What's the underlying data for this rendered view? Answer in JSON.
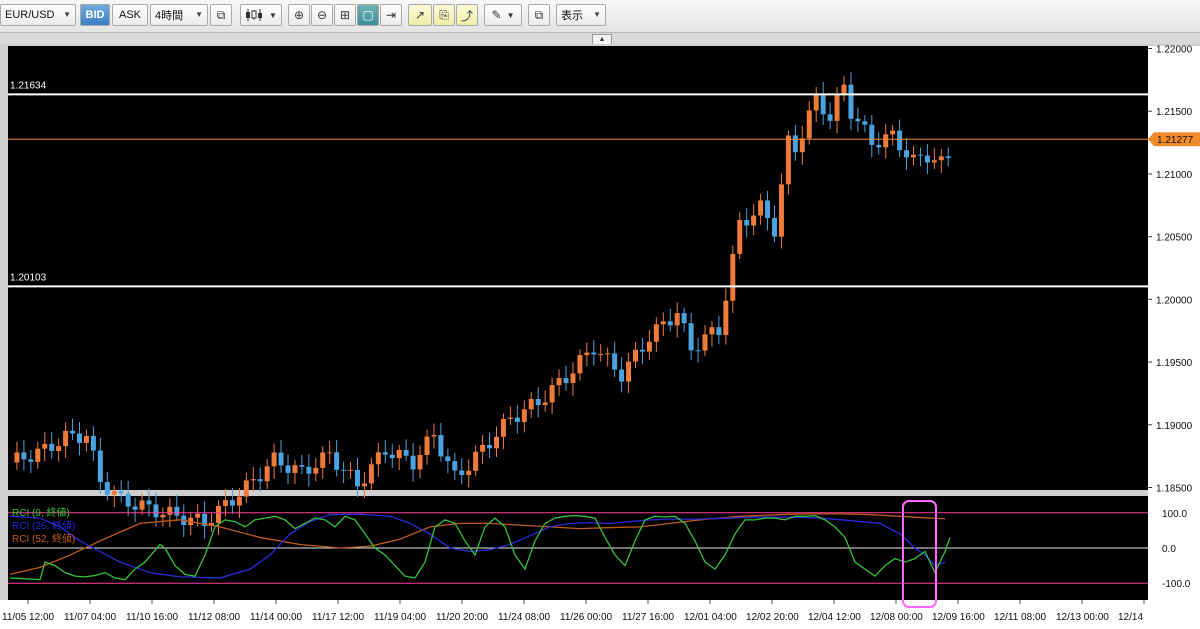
{
  "toolbar": {
    "symbol": "EUR/USD",
    "bid_label": "BID",
    "ask_label": "ASK",
    "timeframe": "4時間",
    "display_label": "表示"
  },
  "chart_data": {
    "type": "candlestick",
    "symbol": "EUR/USD",
    "timeframe": "4h",
    "price_axis": {
      "ylim": [
        1.1848,
        1.2202
      ],
      "ticks": [
        1.22,
        1.215,
        1.21,
        1.205,
        1.2,
        1.195,
        1.19,
        1.185
      ]
    },
    "x_labels": [
      "11/05 12:00",
      "11/07 04:00",
      "11/10 16:00",
      "11/12 08:00",
      "11/14 00:00",
      "11/17 12:00",
      "11/19 04:00",
      "11/20 20:00",
      "11/24 08:00",
      "11/26 00:00",
      "11/27 16:00",
      "12/01 04:00",
      "12/02 20:00",
      "12/04 12:00",
      "12/08 00:00",
      "12/09 16:00",
      "12/11 08:00",
      "12/13 00:00",
      "12/14"
    ],
    "horizontal_lines": [
      {
        "label": "1.21634",
        "value": 1.21634,
        "color": "#ffffff"
      },
      {
        "label": "1.20103",
        "value": 1.20103,
        "color": "#ffffff"
      },
      {
        "label": "1.21277",
        "value": 1.21277,
        "color": "#f08a2c",
        "current_price": true
      }
    ],
    "bull_color": "#ef7b3a",
    "bear_color": "#4aa3df",
    "close_path": [
      [
        0,
        1.187
      ],
      [
        5,
        1.188
      ],
      [
        8,
        1.189
      ],
      [
        11,
        1.1892
      ],
      [
        13,
        1.1855
      ],
      [
        16,
        1.184
      ],
      [
        22,
        1.183
      ],
      [
        28,
        1.1822
      ],
      [
        34,
        1.185
      ],
      [
        38,
        1.1872
      ],
      [
        42,
        1.1862
      ],
      [
        46,
        1.1876
      ],
      [
        50,
        1.1852
      ],
      [
        54,
        1.188
      ],
      [
        58,
        1.187
      ],
      [
        61,
        1.1892
      ],
      [
        64,
        1.1858
      ],
      [
        66,
        1.1868
      ],
      [
        72,
        1.1905
      ],
      [
        76,
        1.1918
      ],
      [
        80,
        1.1938
      ],
      [
        84,
        1.1962
      ],
      [
        88,
        1.194
      ],
      [
        92,
        1.197
      ],
      [
        96,
        1.199
      ],
      [
        98,
        1.196
      ],
      [
        100,
        1.197
      ],
      [
        102,
        1.1975
      ],
      [
        105,
        1.206
      ],
      [
        108,
        1.2073
      ],
      [
        110,
        1.2056
      ],
      [
        112,
        1.2125
      ],
      [
        113,
        1.212
      ],
      [
        116,
        1.216
      ],
      [
        118,
        1.2145
      ],
      [
        120,
        1.217
      ],
      [
        121,
        1.215
      ],
      [
        124,
        1.2125
      ],
      [
        127,
        1.213
      ],
      [
        130,
        1.211
      ],
      [
        132,
        1.2115
      ],
      [
        134,
        1.2108
      ],
      [
        137,
        1.2125
      ]
    ],
    "candles_start_x": 10,
    "candle_spacing": 6.95,
    "rci_panel": {
      "title": "RCI",
      "ylim": [
        -100,
        100
      ],
      "ticks": [
        100.0,
        0.0,
        -100.0
      ],
      "reference_lines": [
        80,
        0,
        -80
      ],
      "series": [
        {
          "name": "RCI (9, 終値)",
          "color": "#35c23a",
          "values": [
            [
              10,
              -85
            ],
            [
              40,
              -90
            ],
            [
              45,
              -40
            ],
            [
              55,
              -50
            ],
            [
              65,
              -70
            ],
            [
              75,
              -80
            ],
            [
              85,
              -82
            ],
            [
              95,
              -78
            ],
            [
              105,
              -70
            ],
            [
              115,
              -85
            ],
            [
              125,
              -90
            ],
            [
              135,
              -60
            ],
            [
              145,
              -40
            ],
            [
              160,
              10
            ],
            [
              165,
              0
            ],
            [
              175,
              -50
            ],
            [
              185,
              -75
            ],
            [
              195,
              -80
            ],
            [
              205,
              -20
            ],
            [
              215,
              60
            ],
            [
              225,
              80
            ],
            [
              235,
              75
            ],
            [
              245,
              60
            ],
            [
              255,
              80
            ],
            [
              265,
              85
            ],
            [
              275,
              90
            ],
            [
              285,
              80
            ],
            [
              295,
              55
            ],
            [
              305,
              70
            ],
            [
              315,
              85
            ],
            [
              325,
              80
            ],
            [
              335,
              60
            ],
            [
              345,
              90
            ],
            [
              355,
              80
            ],
            [
              365,
              40
            ],
            [
              375,
              0
            ],
            [
              385,
              -20
            ],
            [
              395,
              -50
            ],
            [
              405,
              -80
            ],
            [
              415,
              -85
            ],
            [
              425,
              -40
            ],
            [
              435,
              60
            ],
            [
              445,
              80
            ],
            [
              455,
              70
            ],
            [
              465,
              20
            ],
            [
              475,
              -20
            ],
            [
              485,
              60
            ],
            [
              495,
              85
            ],
            [
              505,
              60
            ],
            [
              515,
              -20
            ],
            [
              525,
              -60
            ],
            [
              535,
              20
            ],
            [
              545,
              70
            ],
            [
              555,
              85
            ],
            [
              565,
              90
            ],
            [
              575,
              92
            ],
            [
              585,
              90
            ],
            [
              595,
              85
            ],
            [
              605,
              30
            ],
            [
              615,
              -20
            ],
            [
              625,
              -50
            ],
            [
              635,
              20
            ],
            [
              645,
              80
            ],
            [
              655,
              90
            ],
            [
              665,
              88
            ],
            [
              675,
              90
            ],
            [
              685,
              70
            ],
            [
              695,
              20
            ],
            [
              705,
              -40
            ],
            [
              715,
              -60
            ],
            [
              725,
              -20
            ],
            [
              735,
              40
            ],
            [
              745,
              80
            ],
            [
              755,
              80
            ],
            [
              765,
              85
            ],
            [
              775,
              85
            ],
            [
              785,
              80
            ],
            [
              795,
              90
            ],
            [
              805,
              90
            ],
            [
              815,
              92
            ],
            [
              825,
              80
            ],
            [
              835,
              60
            ],
            [
              845,
              30
            ],
            [
              855,
              -40
            ],
            [
              865,
              -60
            ],
            [
              875,
              -80
            ],
            [
              885,
              -50
            ],
            [
              895,
              -30
            ],
            [
              905,
              -40
            ],
            [
              915,
              -30
            ],
            [
              925,
              -10
            ],
            [
              935,
              -70
            ],
            [
              945,
              -10
            ],
            [
              950,
              30
            ]
          ]
        },
        {
          "name": "RCI (26, 終値)",
          "color": "#2a2ad8",
          "values": [
            [
              10,
              90
            ],
            [
              40,
              85
            ],
            [
              60,
              60
            ],
            [
              80,
              20
            ],
            [
              100,
              -10
            ],
            [
              120,
              -40
            ],
            [
              150,
              -70
            ],
            [
              180,
              -82
            ],
            [
              220,
              -85
            ],
            [
              250,
              -60
            ],
            [
              270,
              -20
            ],
            [
              290,
              40
            ],
            [
              310,
              75
            ],
            [
              330,
              95
            ],
            [
              360,
              96
            ],
            [
              390,
              90
            ],
            [
              410,
              70
            ],
            [
              430,
              40
            ],
            [
              450,
              0
            ],
            [
              470,
              -10
            ],
            [
              490,
              -5
            ],
            [
              510,
              10
            ],
            [
              530,
              35
            ],
            [
              550,
              60
            ],
            [
              570,
              70
            ],
            [
              590,
              72
            ],
            [
              610,
              70
            ],
            [
              630,
              75
            ],
            [
              650,
              80
            ],
            [
              670,
              82
            ],
            [
              700,
              82
            ],
            [
              730,
              85
            ],
            [
              760,
              88
            ],
            [
              790,
              88
            ],
            [
              820,
              85
            ],
            [
              850,
              78
            ],
            [
              880,
              70
            ],
            [
              900,
              40
            ],
            [
              915,
              0
            ],
            [
              925,
              -20
            ],
            [
              935,
              -50
            ],
            [
              945,
              -40
            ]
          ]
        },
        {
          "name": "RCI (52, 終値)",
          "color": "#c05a1a",
          "values": [
            [
              10,
              -75
            ],
            [
              40,
              -55
            ],
            [
              70,
              -20
            ],
            [
              100,
              20
            ],
            [
              140,
              70
            ],
            [
              180,
              80
            ],
            [
              220,
              60
            ],
            [
              260,
              30
            ],
            [
              300,
              10
            ],
            [
              340,
              0
            ],
            [
              370,
              5
            ],
            [
              400,
              25
            ],
            [
              430,
              60
            ],
            [
              460,
              70
            ],
            [
              490,
              70
            ],
            [
              520,
              65
            ],
            [
              550,
              60
            ],
            [
              580,
              55
            ],
            [
              610,
              58
            ],
            [
              640,
              60
            ],
            [
              670,
              70
            ],
            [
              700,
              80
            ],
            [
              740,
              90
            ],
            [
              780,
              95
            ],
            [
              810,
              97
            ],
            [
              840,
              97
            ],
            [
              870,
              95
            ],
            [
              900,
              90
            ],
            [
              930,
              85
            ],
            [
              945,
              83
            ]
          ]
        }
      ],
      "highlight_box_color": "#ff66ff"
    }
  }
}
